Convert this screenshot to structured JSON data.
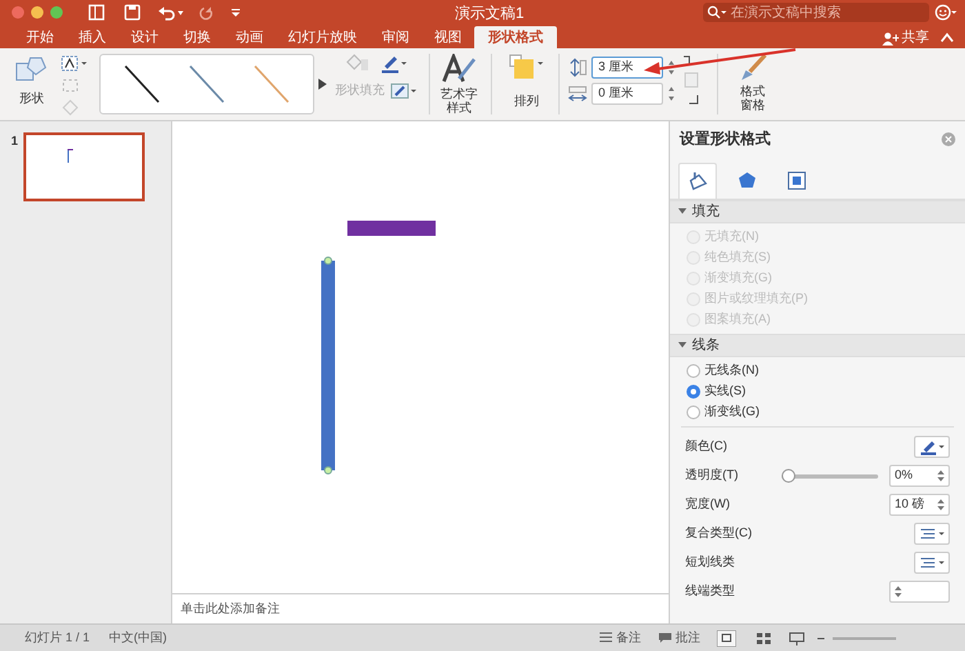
{
  "window": {
    "title": "演示文稿1",
    "search": {
      "placeholder": "在演示文稿中搜索"
    }
  },
  "tabs": [
    {
      "label": "开始",
      "selected": false
    },
    {
      "label": "插入",
      "selected": false
    },
    {
      "label": "设计",
      "selected": false
    },
    {
      "label": "切换",
      "selected": false
    },
    {
      "label": "动画",
      "selected": false
    },
    {
      "label": "幻灯片放映",
      "selected": false
    },
    {
      "label": "审阅",
      "selected": false
    },
    {
      "label": "视图",
      "selected": false
    },
    {
      "label": "形状格式",
      "selected": true
    }
  ],
  "share": {
    "label": "共享"
  },
  "ribbon": {
    "shapes": "形状",
    "shape_fill": {
      "label": "形状填充",
      "disabled": true
    },
    "wordart": "艺术字样式",
    "arrange": "排列",
    "height": "3 厘米",
    "width": "0 厘米",
    "format_pane": "格式窗格"
  },
  "slides": [
    {
      "number": "1",
      "selected": true
    }
  ],
  "notes": {
    "placeholder": "单击此处添加备注"
  },
  "format_pane": {
    "title": "设置形状格式",
    "icon_tabs": [
      {
        "selected": true
      },
      {
        "selected": false
      },
      {
        "selected": false
      }
    ],
    "sections": [
      {
        "title": "填充",
        "expanded": true,
        "options": [
          {
            "label": "无填充(N)",
            "selected": false,
            "disabled": true
          },
          {
            "label": "纯色填充(S)",
            "selected": false,
            "disabled": true
          },
          {
            "label": "渐变填充(G)",
            "selected": false,
            "disabled": true
          },
          {
            "label": "图片或纹理填充(P)",
            "selected": false,
            "disabled": true
          },
          {
            "label": "图案填充(A)",
            "selected": false,
            "disabled": true
          }
        ]
      },
      {
        "title": "线条",
        "expanded": true,
        "options": [
          {
            "label": "无线条(N)",
            "selected": false,
            "disabled": false
          },
          {
            "label": "实线(S)",
            "selected": true,
            "disabled": false
          },
          {
            "label": "渐变线(G)",
            "selected": false,
            "disabled": false
          }
        ]
      }
    ],
    "properties": [
      {
        "kind": "color",
        "label": "颜色(C)"
      },
      {
        "kind": "slider",
        "label": "透明度(T)",
        "level": 0,
        "value": "0%"
      },
      {
        "kind": "spin",
        "label": "宽度(W)",
        "value": "10 磅"
      },
      {
        "kind": "menu",
        "label": "复合类型(C)"
      },
      {
        "kind": "menu",
        "label": "短划线类"
      },
      {
        "kind": "spin",
        "label": "线端类型"
      }
    ]
  },
  "status_bar": {
    "slide": "幻灯片 1 / 1",
    "language": "中文(中国)",
    "notes": "备注",
    "comments": "批注"
  }
}
